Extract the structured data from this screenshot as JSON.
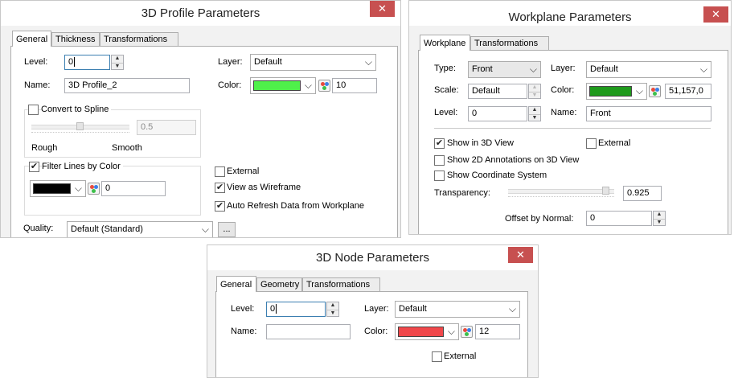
{
  "close_glyph": "✕",
  "check_glyph": "✔",
  "spin_up_glyph": "▲",
  "spin_down_glyph": "▼",
  "chevron_glyph": "⌵",
  "profile": {
    "title": "3D Profile Parameters",
    "tabs": [
      "General",
      "Thickness",
      "Transformations"
    ],
    "level_label": "Level:",
    "level_value": "0",
    "name_label": "Name:",
    "name_value": "3D Profile_2",
    "layer_label": "Layer:",
    "layer_value": "Default",
    "color_label": "Color:",
    "color_swatch": "#4ff04a",
    "color_value": "10",
    "convert_label": "Convert to Spline",
    "convert_checked": false,
    "smooth_value": "0.5",
    "rough_label": "Rough",
    "smooth_label": "Smooth",
    "filter_label": "Filter Lines by Color",
    "filter_checked": true,
    "filter_swatch": "#000000",
    "filter_value": "0",
    "external_label": "External",
    "external_checked": false,
    "wireframe_label": "View as Wireframe",
    "wireframe_checked": true,
    "autorefresh_label": "Auto Refresh Data from Workplane",
    "autorefresh_checked": true,
    "quality_label": "Quality:",
    "quality_value": "Default (Standard)",
    "quality_button": "..."
  },
  "workplane": {
    "title": "Workplane Parameters",
    "tabs": [
      "Workplane",
      "Transformations"
    ],
    "type_label": "Type:",
    "type_value": "Front",
    "layer_label": "Layer:",
    "layer_value": "Default",
    "scale_label": "Scale:",
    "scale_value": "Default",
    "color_label": "Color:",
    "color_swatch": "#1f9a1c",
    "color_value": "51,157,0",
    "level_label": "Level:",
    "level_value": "0",
    "name_label": "Name:",
    "name_value": "Front",
    "show3d_label": "Show in 3D View",
    "show3d_checked": true,
    "external_label": "External",
    "external_checked": false,
    "show2d_label": "Show 2D Annotations on 3D View",
    "show2d_checked": false,
    "coord_label": "Show Coordinate System",
    "coord_checked": false,
    "transparency_label": "Transparency:",
    "transparency_value": "0.925",
    "offset_label": "Offset by Normal:",
    "offset_value": "0"
  },
  "node": {
    "title": "3D Node Parameters",
    "tabs": [
      "General",
      "Geometry",
      "Transformations"
    ],
    "level_label": "Level:",
    "level_value": "0",
    "layer_label": "Layer:",
    "layer_value": "Default",
    "name_label": "Name:",
    "name_value": "",
    "color_label": "Color:",
    "color_swatch": "#f0474a",
    "color_value": "12",
    "external_label": "External",
    "external_checked": false
  }
}
